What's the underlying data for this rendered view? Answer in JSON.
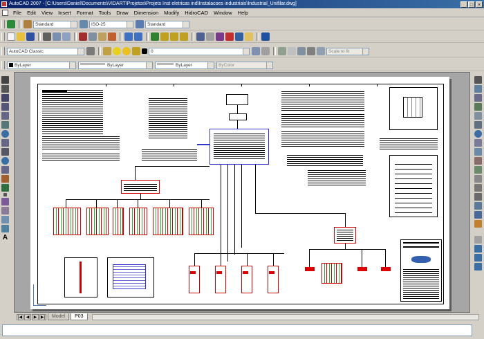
{
  "window": {
    "title": "AutoCAD 2007 - [C:\\Users\\Daniel\\Documents\\VIDART\\Projetos\\Projets Inst eletricas ind\\Instalacoes industriais\\Industrial_Unifilar.dwg]"
  },
  "menu": [
    "File",
    "Edit",
    "View",
    "Insert",
    "Format",
    "Tools",
    "Draw",
    "Dimension",
    "Modify",
    "HidroCAD",
    "Window",
    "Help"
  ],
  "toolbar_styles": {
    "text_style": "Standard",
    "dim_style": "ISO-25",
    "table_style": "Standard"
  },
  "toolbar_workspace": {
    "workspace": "AutoCAD Classic",
    "layer": "0",
    "scale": "Scale to fit"
  },
  "toolbar_properties": {
    "color": "ByLayer",
    "linetype": "ByLayer",
    "lineweight": "ByLayer",
    "plotstyle": "ByColor"
  },
  "layout_tabs": [
    "Model",
    "P03"
  ],
  "accent_colors": {
    "title_bar": "#0a246a",
    "panel_red": "#cc0000",
    "bus_blue": "#3333cc"
  }
}
